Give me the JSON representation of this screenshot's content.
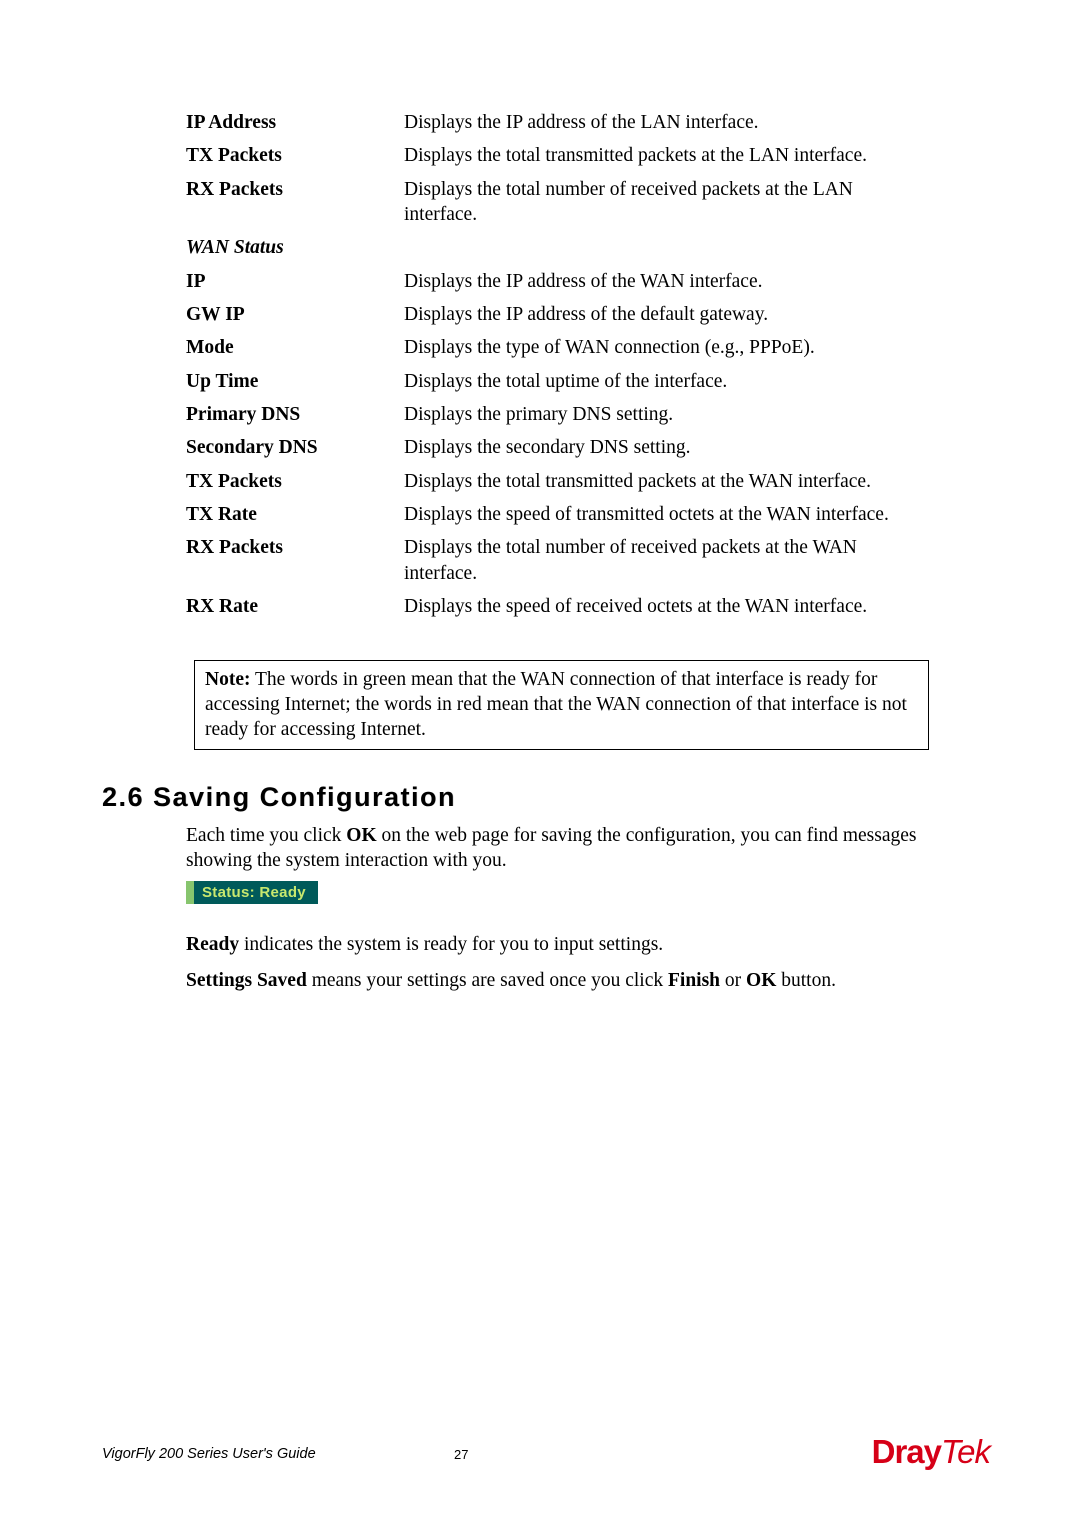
{
  "defs": {
    "ip_address": {
      "term": "IP Address",
      "desc": "Displays the IP address of the LAN interface."
    },
    "tx_packets_lan": {
      "term": "TX Packets",
      "desc": "Displays the total transmitted packets at the LAN interface."
    },
    "rx_packets_lan": {
      "term": "RX Packets",
      "desc": "Displays the total number of received packets at the LAN interface."
    },
    "wan_status": {
      "term": "WAN Status"
    },
    "ip": {
      "term": "IP",
      "desc": "Displays the IP address of the WAN interface."
    },
    "gw_ip": {
      "term": "GW IP",
      "desc": "Displays the IP address of the default gateway."
    },
    "mode": {
      "term": "Mode",
      "desc": "Displays the type of WAN connection (e.g., PPPoE)."
    },
    "up_time": {
      "term": "Up Time",
      "desc": "Displays the total uptime of the interface."
    },
    "primary_dns": {
      "term": "Primary DNS",
      "desc": "Displays the primary DNS setting."
    },
    "secondary_dns": {
      "term": "Secondary DNS",
      "desc": "Displays the secondary DNS setting."
    },
    "tx_packets_wan": {
      "term": "TX Packets",
      "desc": "Displays the total transmitted packets at the WAN interface."
    },
    "tx_rate": {
      "term": "TX Rate",
      "desc": "Displays the speed of transmitted octets at the WAN interface."
    },
    "rx_packets_wan": {
      "term": "RX Packets",
      "desc": "Displays the total number of received packets at the WAN interface."
    },
    "rx_rate": {
      "term": "RX Rate",
      "desc": "Displays the speed of received octets at the WAN interface."
    }
  },
  "note": {
    "label": "Note:",
    "text": " The words in green mean that the WAN connection of that interface is ready for accessing Internet; the words in red mean that the WAN connection of that interface is not ready for accessing Internet."
  },
  "section": {
    "heading": "2.6 Saving Configuration",
    "para1_a": "Each time you click ",
    "para1_b_bold": "OK",
    "para1_c": " on the web page for saving the configuration, you can find messages showing the system interaction with you.",
    "status_text": "Status: Ready",
    "para2_a_bold": "Ready",
    "para2_b": " indicates the system is ready for you to input settings.",
    "para3_a_bold": "Settings Saved",
    "para3_b": " means your settings are saved once you click ",
    "para3_c_bold": "Finish",
    "para3_d": " or ",
    "para3_e_bold": "OK",
    "para3_f": " button."
  },
  "footer": {
    "guide": "VigorFly 200 Series User's Guide",
    "page": "27",
    "logo_a": "Dray",
    "logo_b": "Tek"
  }
}
